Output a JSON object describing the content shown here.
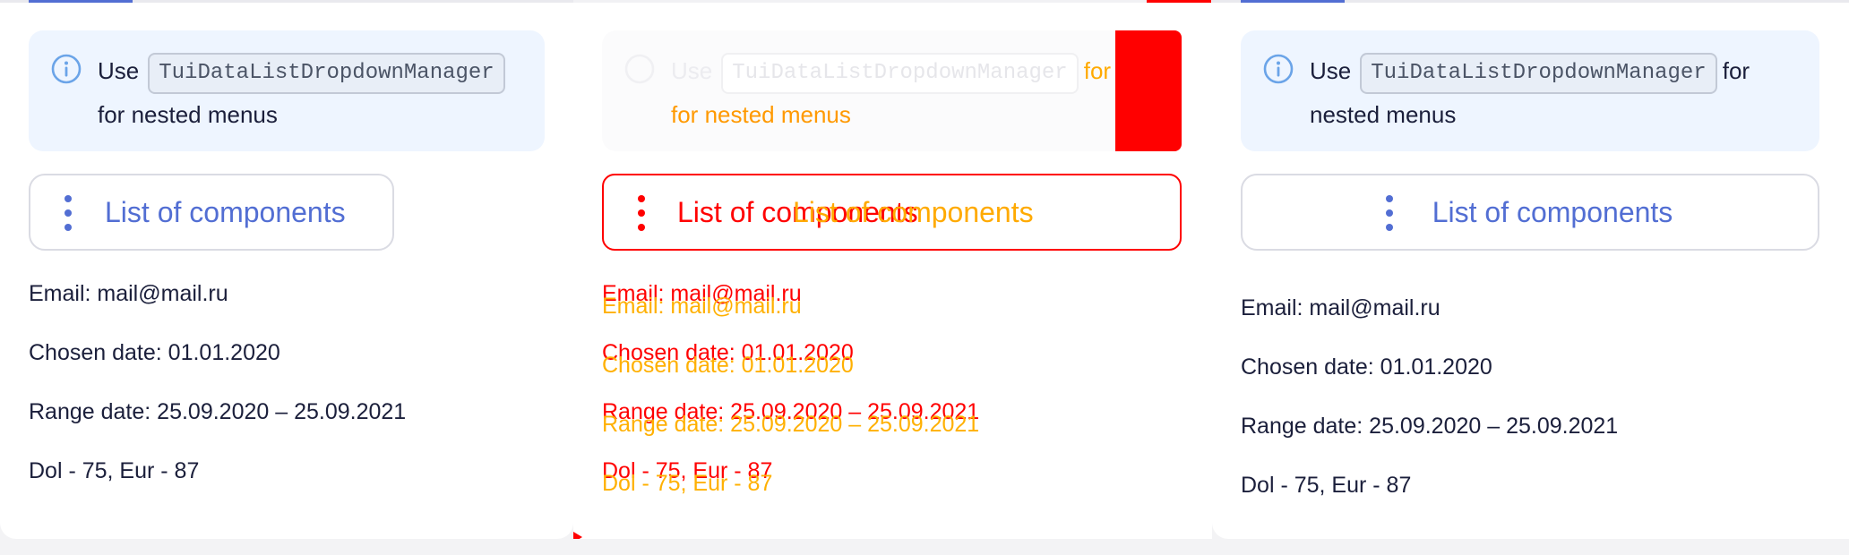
{
  "notice": {
    "prefix": "Use",
    "code": "TuiDataListDropdownManager",
    "suffix_left": "for nested menus",
    "suffix_right_line1": "for",
    "suffix_right_line2": "nested menus",
    "middle_overlay_line2": "for nested menus"
  },
  "dropdown": {
    "label": "List of components",
    "overlay_label": "List of components"
  },
  "info": {
    "email": "Email: mail@mail.ru",
    "chosen_date": "Chosen date: 01.01.2020",
    "range_date": "Range date: 25.09.2020 – 25.09.2021",
    "currency": "Dol - 75, Eur - 87"
  },
  "colors": {
    "accent": "#526ed3",
    "notice_bg": "#eef5ff",
    "text": "#1b1f3b",
    "diff_red": "#ff0000",
    "diff_orange": "#ffaa00"
  },
  "icons": {
    "info": "info-circle-icon",
    "more": "more-vertical-icon"
  }
}
